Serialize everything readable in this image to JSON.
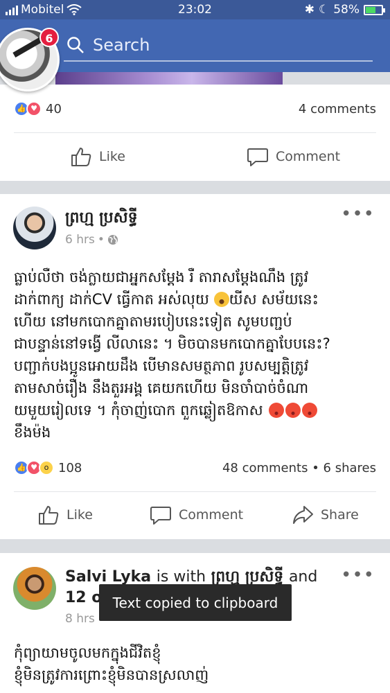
{
  "status_bar": {
    "carrier": "Mobitel",
    "time": "23:02",
    "battery": "58%"
  },
  "header": {
    "search_placeholder": "Search"
  },
  "chat_head": {
    "badge_count": "6"
  },
  "post1": {
    "reaction_count": "40",
    "comments": "4 comments",
    "like_label": "Like",
    "comment_label": "Comment"
  },
  "post2": {
    "author": "ព្រហ្ម ប្រសិទ្ធី",
    "time": "6 hrs",
    "text_lines": [
      "ធ្លាប់លឺថា ចង់ក្លាយជាអ្នកសម្ដែង រឺ តារាសម្ដែងណឹង ត្រូវ",
      "ដាក់ពាក្យ ដាក់CV ធ្វើកាត អស់លុយ",
      "យីស សម័យនេះ",
      "ហើយ នៅមកបោកគ្នាតាមរបៀបនេះទៀត សូមបញ្ជប់",
      "ជាបន្ទាន់នៅទង្វើ លីលានេះ ។ មិចបានមកបោកគ្នាបែបនេះ?",
      "បញ្ជាក់បងប្អូនអោយដឹង បើមានសមត្ថភាព រូបសម្បត្តិត្រូវ",
      "តាមសាច់រឿង នឹងតួរអង្គ គេយកហើយ មិនចាំបាច់ចំណា",
      "យមួយរៀលទេ ។ កុំចាញ់បោក ពួកឆ្លៀតឱកាស",
      "ខឹងម៉ង"
    ],
    "reaction_count": "108",
    "comments": "48 comments",
    "shares": "6 shares",
    "like_label": "Like",
    "comment_label": "Comment",
    "share_label": "Share"
  },
  "post3": {
    "author": "Salvi Lyka",
    "with_word": "is with",
    "tagged": "ព្រហ្ម ប្រសិទ្ធី",
    "and_word": "and",
    "others": "12 others",
    "time": "8 hrs",
    "text_lines": [
      "កុំព្យាយាមចូលមកក្នុងជីវិតខ្ញុំ",
      "ខ្ញុំមិនត្រូវការព្រោះខ្ញុំមិនបានស្រលាញ់"
    ]
  },
  "toast": {
    "text": "Text copied to clipboard"
  }
}
